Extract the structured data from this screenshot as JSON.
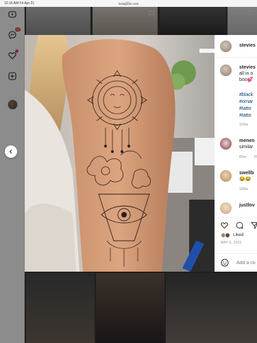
{
  "status_bar": {
    "time": "12:16 AM  Fri Apr 21",
    "url": "instagram.com"
  },
  "nav": {
    "messages_badge": "12",
    "activity_badge": ""
  },
  "post": {
    "author": {
      "username": "stevies"
    },
    "caption": {
      "username": "stevies",
      "line1": "all in o",
      "line2": "boo💕",
      "hashtags": [
        "#black",
        "#ornar",
        "#tatto",
        "#tatto"
      ],
      "age": "102w"
    },
    "comments": [
      {
        "username": "menen",
        "text": "similar",
        "age": "82w",
        "reply": "R"
      },
      {
        "username": "swellb",
        "text": "😂😂",
        "age": "100w"
      },
      {
        "username": "justlov",
        "text": ""
      }
    ],
    "liked_label": "Liked",
    "date": "MAY 6, 2021",
    "comment_placeholder": "Add a co"
  },
  "colors": {
    "link": "#00376b",
    "badge": "#ed4956",
    "muted": "#8e8e8e"
  }
}
